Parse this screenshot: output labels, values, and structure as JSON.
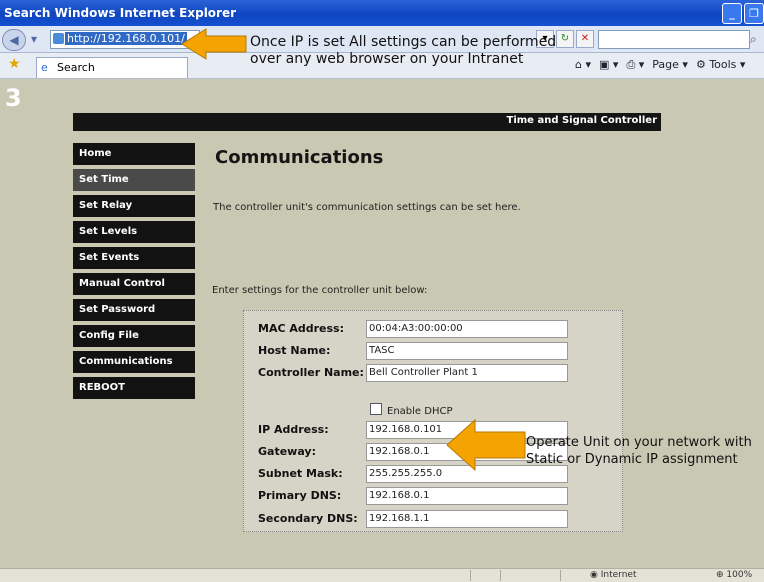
{
  "window": {
    "title": "Search  Windows Internet Explorer",
    "buttons": [
      "_",
      "❐"
    ]
  },
  "address_bar": {
    "url": "http://192.168.0.101/"
  },
  "tab": {
    "label": "Search"
  },
  "toolbar": {
    "items": [
      "Page",
      "Tools"
    ]
  },
  "callouts": {
    "top_line1": "Once IP is set All settings can be performed",
    "top_line2": "over any web browser on your Intranet",
    "right_line1": "Operate Unit on your network with",
    "right_line2": "Static or Dynamic IP assignment"
  },
  "slide_number": "3",
  "page": {
    "header_title": "Time and Signal Controller",
    "nav": [
      "Home",
      "Set Time",
      "Set Relay",
      "Set Levels",
      "Set Events",
      "Manual Control",
      "Set Password",
      "Config File",
      "Communications",
      "REBOOT"
    ],
    "title": "Communications",
    "intro": "The controller unit's communication settings can be set here.",
    "enter_text": "Enter settings for the controller unit below:"
  },
  "form": {
    "mac_label": "MAC Address:",
    "mac_value": "00:04:A3:00:00:00",
    "host_label": "Host Name:",
    "host_value": "TASC",
    "cname_label": "Controller Name:",
    "cname_value": "Bell Controller Plant 1",
    "dhcp_label": "Enable DHCP",
    "ip_label": "IP Address:",
    "ip_value": "192.168.0.101",
    "gw_label": "Gateway:",
    "gw_value": "192.168.0.1",
    "subnet_label": "Subnet Mask:",
    "subnet_value": "255.255.255.0",
    "pdns_label": "Primary DNS:",
    "pdns_value": "192.168.0.1",
    "sdns_label": "Secondary DNS:",
    "sdns_value": "192.168.1.1"
  },
  "status_bar": {
    "zone": "Internet",
    "zoom": "100%"
  },
  "colors": {
    "page_bg": "#c9c8b2",
    "nav_bg": "#121212",
    "arrow": "#f5a300",
    "title_bar": "#0f45c0"
  }
}
